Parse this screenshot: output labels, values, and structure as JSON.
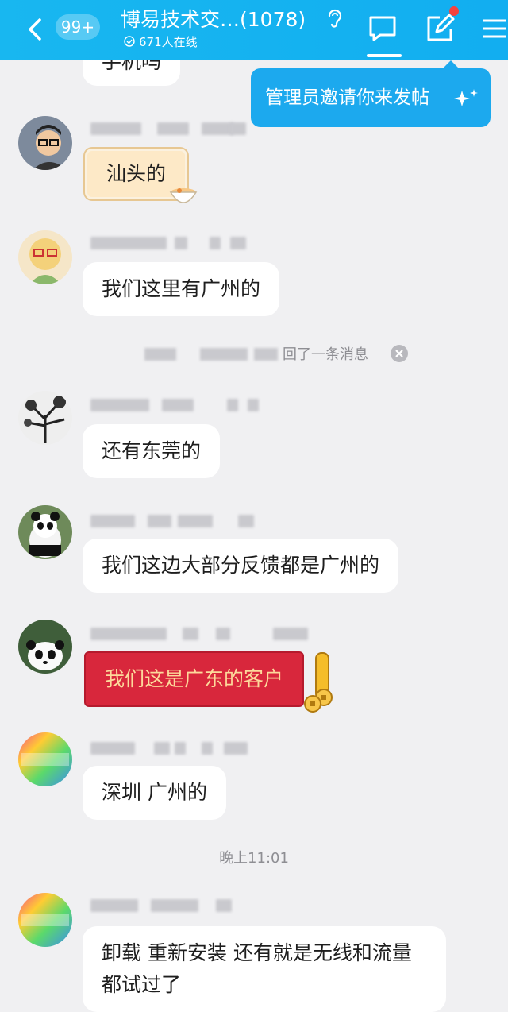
{
  "header": {
    "unread_badge": "99+",
    "title": "博易技术交…(1078)",
    "online_text": "671人在线"
  },
  "admin_popup": {
    "text": "管理员邀请你来发帖"
  },
  "messages": [
    {
      "text": "手机吗"
    },
    {
      "text": "汕头的"
    },
    {
      "text": "我们这里有广州的"
    },
    {
      "text": "还有东莞的"
    },
    {
      "text": "我们这边大部分反馈都是广州的"
    },
    {
      "text": "我们这是广东的客户"
    },
    {
      "text": "深圳 广州的"
    },
    {
      "text": "卸载 重新安装 还有就是无线和流量都试过了"
    }
  ],
  "recall_notice": {
    "text": "回了一条消息"
  },
  "time_divider": {
    "text": "晚上11:01"
  },
  "colors": {
    "header_bg": "#18b7f0",
    "bubble_bg": "#ffffff",
    "page_bg": "#f0f0f2",
    "red_bubble": "#d8273c"
  }
}
